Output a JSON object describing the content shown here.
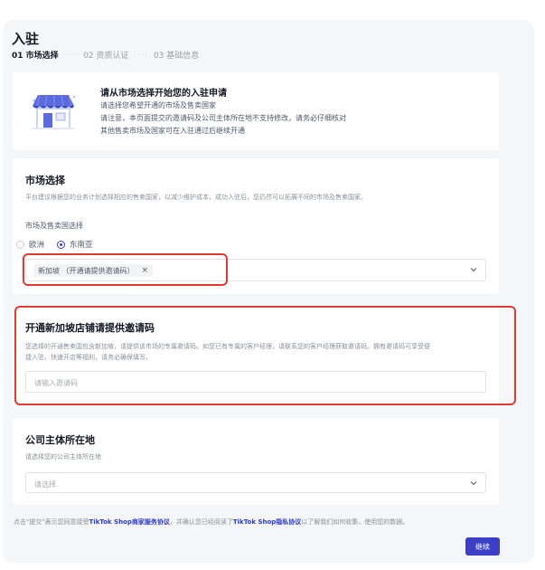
{
  "header": {
    "title": "入驻",
    "steps": [
      {
        "label": "01 市场选择",
        "active": true
      },
      {
        "label": "02 资质认证",
        "active": false
      },
      {
        "label": "03 基础信息",
        "active": false
      }
    ]
  },
  "intro": {
    "title": "请从市场选择开始您的入驻申请",
    "lines": [
      "请选择您希望开通的市场及售卖国家",
      "请注意，本页面提交的邀请码及公司主体所在地不支持修改，请务必仔细核对",
      "其他售卖市场及国家可在入驻通过后继续开通"
    ],
    "illustration": "storefront-icon"
  },
  "market": {
    "title": "市场选择",
    "desc": "平台建议根据您的业务计划选择相应的售卖国家，以减少维护成本，成功入驻后，您仍然可以拓展不同的市场及售卖国家。",
    "field_label": "市场及售卖国选择",
    "options": [
      {
        "label": "欧洲",
        "checked": false
      },
      {
        "label": "东南亚",
        "checked": true
      }
    ],
    "selected_tag": "新加坡 （开通请提供邀请码）",
    "tag_remove": "×"
  },
  "invite": {
    "title": "开通新加坡店铺请提供邀请码",
    "desc_line1": "您选择的开通售卖国包含新加坡，请提供该市场的专属邀请码。如您已有专属的客户经理，请联系您的客户经理获取邀请码。拥有邀请码可享受便",
    "desc_line2": "捷入驻、快速开店等福利，请务必确保填写。",
    "placeholder": "请输入邀请码"
  },
  "company": {
    "title": "公司主体所在地",
    "desc": "请选择您的公司主体所在地",
    "placeholder": "请选择"
  },
  "footer": {
    "note_prefix": "点击\"提交\"表示您同意接受",
    "link1": "TikTok Shop商家服务协议",
    "note_mid": "，并确认您已经阅读了",
    "link2": "TikTok Shop隐私协议",
    "note_suffix": "以了解我们如何收集、使用您的数据。",
    "submit_label": "继续"
  },
  "colors": {
    "accent": "#3b3fc7",
    "highlight": "#e03b32",
    "panel_bg": "#f5f6f7"
  }
}
